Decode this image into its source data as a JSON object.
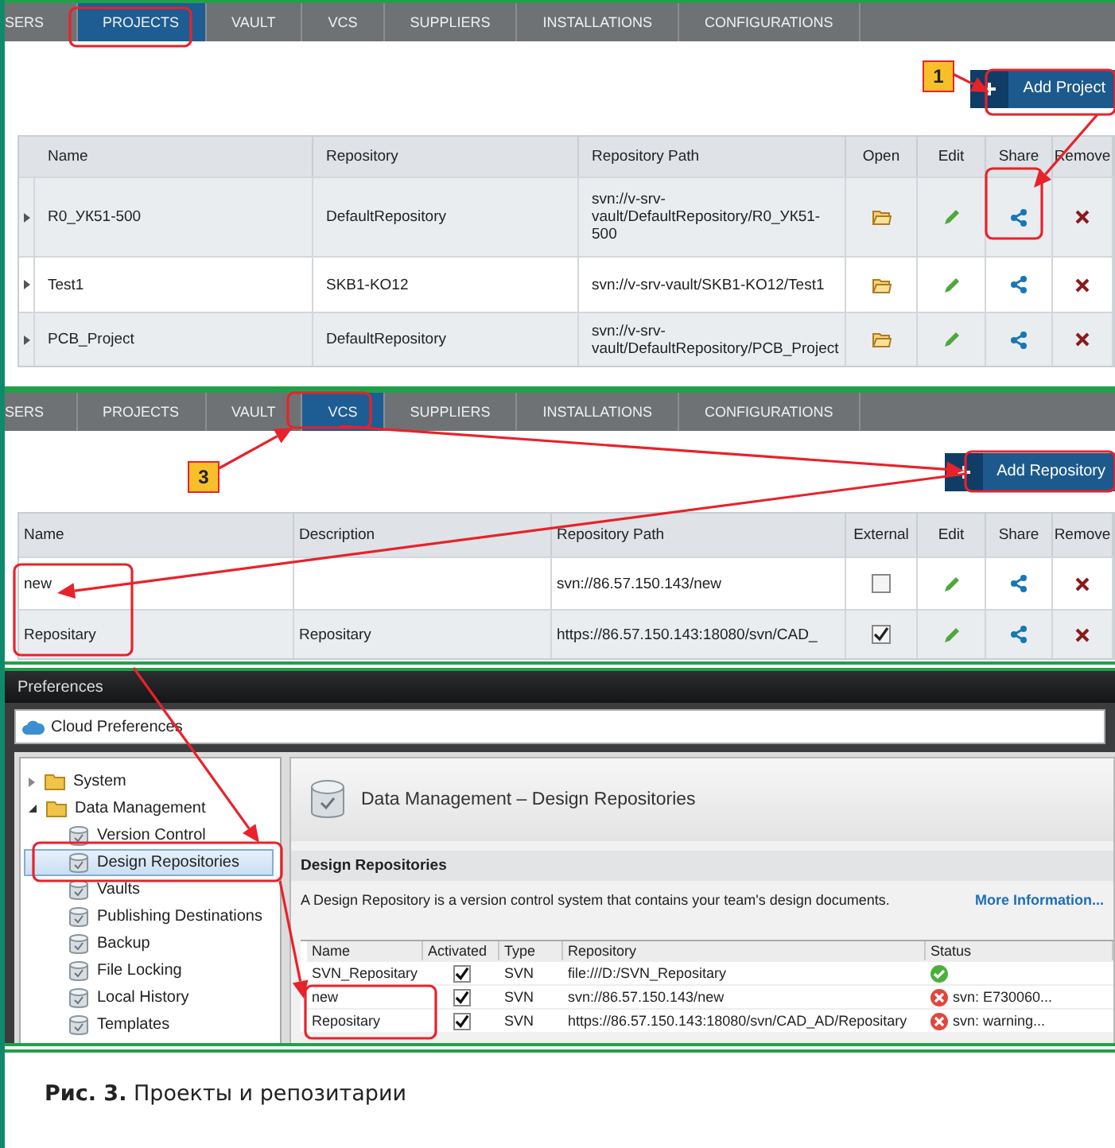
{
  "projects_panel": {
    "tabs": [
      {
        "label": "SERS",
        "selected": false
      },
      {
        "label": "PROJECTS",
        "selected": true
      },
      {
        "label": "VAULT",
        "selected": false
      },
      {
        "label": "VCS",
        "selected": false
      },
      {
        "label": "SUPPLIERS",
        "selected": false
      },
      {
        "label": "INSTALLATIONS",
        "selected": false
      },
      {
        "label": "CONFIGURATIONS",
        "selected": false
      }
    ],
    "add_button": {
      "label": "Add Project"
    },
    "columns": [
      "Name",
      "Repository",
      "Repository Path",
      "Open",
      "Edit",
      "Share",
      "Remove"
    ],
    "rows": [
      {
        "name": "R0_УК51-500",
        "repository": "DefaultRepository",
        "path": "svn://v-srv-vault/DefaultRepository/R0_УК51-500"
      },
      {
        "name": "Test1",
        "repository": "SKB1-KO12",
        "path": "svn://v-srv-vault/SKB1-KO12/Test1"
      },
      {
        "name": "PCB_Project",
        "repository": "DefaultRepository",
        "path": "svn://v-srv-vault/DefaultRepository/PCB_Project"
      }
    ]
  },
  "vcs_panel": {
    "tabs": [
      {
        "label": "SERS",
        "selected": false
      },
      {
        "label": "PROJECTS",
        "selected": false
      },
      {
        "label": "VAULT",
        "selected": false
      },
      {
        "label": "VCS",
        "selected": true
      },
      {
        "label": "SUPPLIERS",
        "selected": false
      },
      {
        "label": "INSTALLATIONS",
        "selected": false
      },
      {
        "label": "CONFIGURATIONS",
        "selected": false
      }
    ],
    "add_button": {
      "label": "Add Repository"
    },
    "columns": [
      "Name",
      "Description",
      "Repository Path",
      "External",
      "Edit",
      "Share",
      "Remove"
    ],
    "rows": [
      {
        "name": "new",
        "path": "svn://86.57.150.143/new",
        "external": false
      },
      {
        "name": "Repositary",
        "description": "Repositary",
        "path": "https://86.57.150.143:18080/svn/CAD_",
        "external": true
      }
    ]
  },
  "preferences": {
    "title": "Preferences",
    "header": "Cloud Preferences",
    "tree": [
      {
        "label": "System",
        "expanded": false,
        "selected": false
      },
      {
        "label": "Data Management",
        "expanded": true,
        "selected": false,
        "children": [
          {
            "label": "Version Control",
            "selected": false
          },
          {
            "label": "Design Repositories",
            "selected": true
          },
          {
            "label": "Vaults",
            "selected": false
          },
          {
            "label": "Publishing Destinations",
            "selected": false
          },
          {
            "label": "Backup",
            "selected": false
          },
          {
            "label": "File Locking",
            "selected": false
          },
          {
            "label": "Local History",
            "selected": false
          },
          {
            "label": "Templates",
            "selected": false
          }
        ]
      }
    ],
    "page_title": "Data Management – Design Repositories",
    "section": "Design Repositories",
    "description": "A Design Repository is a version control system that contains your team's design documents.",
    "link": "More Information...",
    "columns": [
      "Name",
      "Activated",
      "Type",
      "Repository",
      "Status"
    ],
    "rows": [
      {
        "name": "SVN_Repositary",
        "activated": true,
        "type": "SVN",
        "repository": "file:///D:/SVN_Repositary",
        "status": {
          "kind": "ok"
        }
      },
      {
        "name": "new",
        "activated": true,
        "type": "SVN",
        "repository": "svn://86.57.150.143/new",
        "status": {
          "kind": "error",
          "text": "svn: E730060..."
        }
      },
      {
        "name": "Repositary",
        "activated": true,
        "type": "SVN",
        "repository": "https://86.57.150.143:18080/svn/CAD_AD/Repositary",
        "status": {
          "kind": "error",
          "text": "svn: warning..."
        }
      }
    ]
  },
  "callouts": [
    {
      "label": "1"
    },
    {
      "label": "3"
    }
  ],
  "caption": "**Рис. 3.** Проекты и репозитарии"
}
